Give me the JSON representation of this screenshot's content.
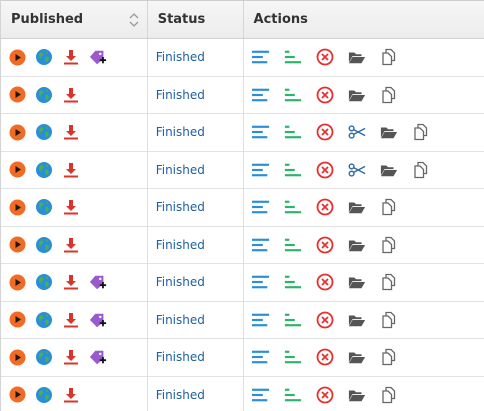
{
  "columns": {
    "published": "Published",
    "status": "Status",
    "actions": "Actions"
  },
  "icons": {
    "play": "play-icon",
    "globe": "globe-icon",
    "download": "download-icon",
    "tag": "tag-add-icon",
    "align_left": "align-left-icon",
    "align_center": "align-bars-icon",
    "cancel": "cancel-icon",
    "cut": "scissors-icon",
    "folder": "folder-open-icon",
    "copy": "copy-icon"
  },
  "colors": {
    "play": "#f26b24",
    "status_text": "#1e5fa0",
    "download": "#d9342b",
    "tag": "#9b59d0",
    "blue_lines": "#2a8fd6",
    "green_lines": "#2bb56a",
    "cancel": "#e8312f",
    "scissors": "#2b6ca8",
    "folder": "#555555",
    "copy": "#666666"
  },
  "rows": [
    {
      "status": "Finished",
      "tag": true,
      "cut": false
    },
    {
      "status": "Finished",
      "tag": false,
      "cut": false
    },
    {
      "status": "Finished",
      "tag": false,
      "cut": true
    },
    {
      "status": "Finished",
      "tag": false,
      "cut": true
    },
    {
      "status": "Finished",
      "tag": false,
      "cut": false
    },
    {
      "status": "Finished",
      "tag": false,
      "cut": false
    },
    {
      "status": "Finished",
      "tag": true,
      "cut": false
    },
    {
      "status": "Finished",
      "tag": true,
      "cut": false
    },
    {
      "status": "Finished",
      "tag": true,
      "cut": false
    },
    {
      "status": "Finished",
      "tag": false,
      "cut": false
    }
  ]
}
